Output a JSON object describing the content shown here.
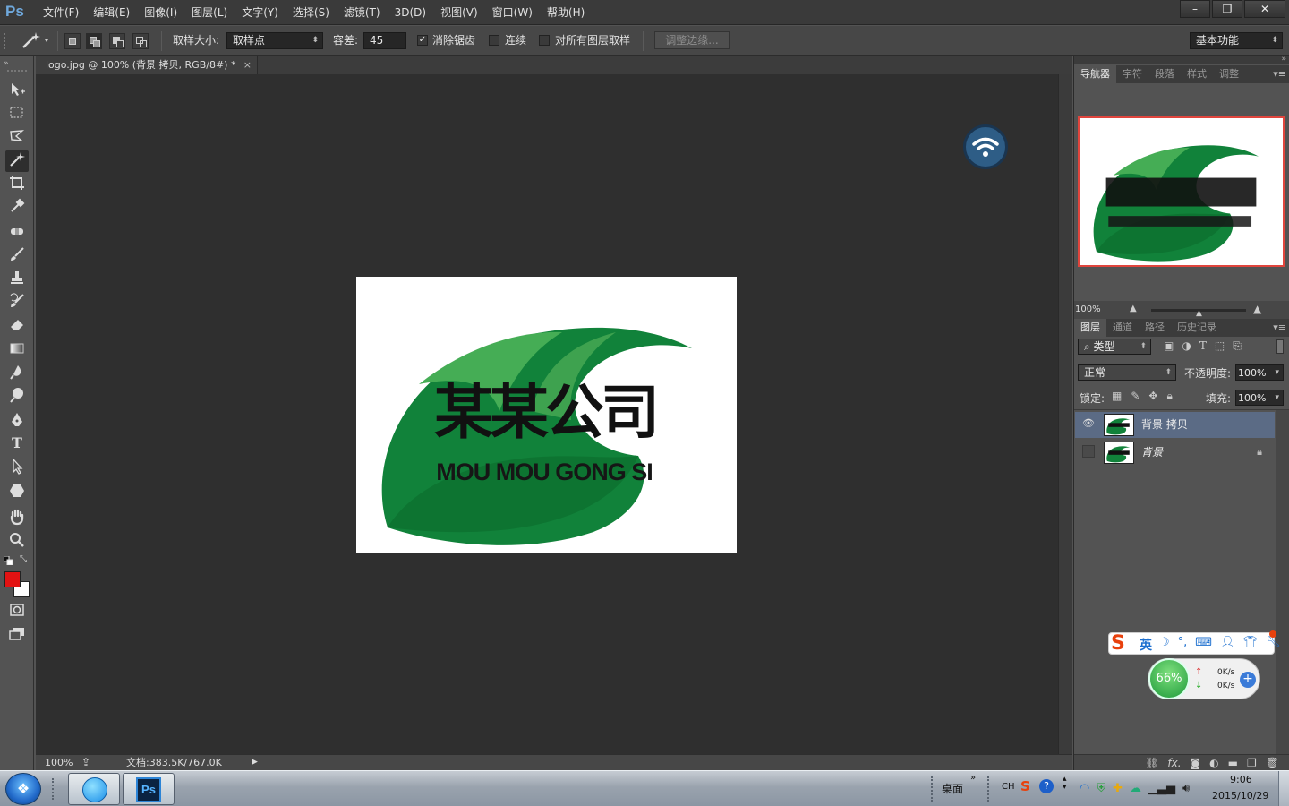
{
  "app": {
    "logo": "Ps"
  },
  "menubar": {
    "items": [
      "文件(F)",
      "编辑(E)",
      "图像(I)",
      "图层(L)",
      "文字(Y)",
      "选择(S)",
      "滤镜(T)",
      "3D(D)",
      "视图(V)",
      "窗口(W)",
      "帮助(H)"
    ]
  },
  "window_buttons": {
    "minimize": "–",
    "restore": "❐",
    "close": "✕"
  },
  "options": {
    "sample_size_label": "取样大小:",
    "sample_size_value": "取样点",
    "tolerance_label": "容差:",
    "tolerance_value": "45",
    "antialias_label": "消除锯齿",
    "antialias_checked": true,
    "contiguous_label": "连续",
    "sample_all_label": "对所有图层取样",
    "refine_edge_label": "调整边缘...",
    "workspace_value": "基本功能"
  },
  "document": {
    "tab_title": "logo.jpg @ 100% (背景 拷贝, RGB/8#) *",
    "close": "×",
    "zoom": "100%",
    "doc_info": "文档:383.5K/767.0K"
  },
  "logo_image": {
    "cn_text": "某某公司",
    "en_text": "MOU MOU GONG SI",
    "green_dark": "#0f7a2e",
    "green_light": "#3aa348"
  },
  "panels": {
    "top_tabs": [
      "导航器",
      "字符",
      "段落",
      "样式",
      "调整"
    ],
    "nav_zoom": "100%",
    "layer_tabs": [
      "图层",
      "通道",
      "路径",
      "历史记录"
    ],
    "filter_label": "类型",
    "blend_mode": "正常",
    "opacity_label": "不透明度:",
    "opacity_value": "100%",
    "lock_label": "锁定:",
    "fill_label": "填充:",
    "fill_value": "100%",
    "layers": [
      {
        "name": "背景 拷贝",
        "visible": true,
        "selected": true
      },
      {
        "name": "背景",
        "visible": false,
        "selected": false,
        "locked": true
      }
    ]
  },
  "ime": {
    "lang": "英"
  },
  "net_widget": {
    "percent": "66%",
    "up": "0K/s",
    "down": "0K/s"
  },
  "taskbar": {
    "desktop_label": "桌面",
    "lang": "CH",
    "time": "9:06",
    "date": "2015/10/29"
  }
}
